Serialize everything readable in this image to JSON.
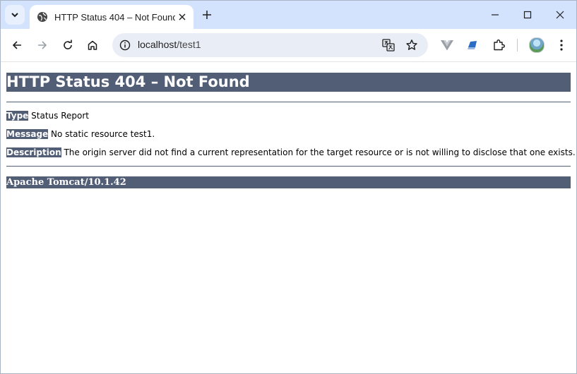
{
  "browser": {
    "tab": {
      "title": "HTTP Status 404 – Not Found"
    },
    "address": {
      "host": "localhost",
      "path": "/test1"
    }
  },
  "page": {
    "heading": "HTTP Status 404 – Not Found",
    "type": {
      "label": "Type",
      "value": "Status Report"
    },
    "message": {
      "label": "Message",
      "value": "No static resource test1."
    },
    "description": {
      "label": "Description",
      "value": "The origin server did not find a current representation for the target resource or is not willing to disclose that one exists."
    },
    "footer": "Apache Tomcat/10.1.42"
  },
  "colors": {
    "tomcat_bar": "#525d76",
    "tabstrip": "#d3e3fd",
    "omnibox": "#e9eef6"
  },
  "icons": [
    "tab-search-icon",
    "globe-icon",
    "close-icon",
    "plus-icon",
    "minimize-icon",
    "maximize-icon",
    "window-close-icon",
    "back-icon",
    "forward-icon",
    "reload-icon",
    "home-icon",
    "site-info-icon",
    "translate-icon",
    "star-icon",
    "vuejs-icon",
    "extension-blue-icon",
    "puzzle-icon",
    "avatar",
    "more-icon"
  ]
}
